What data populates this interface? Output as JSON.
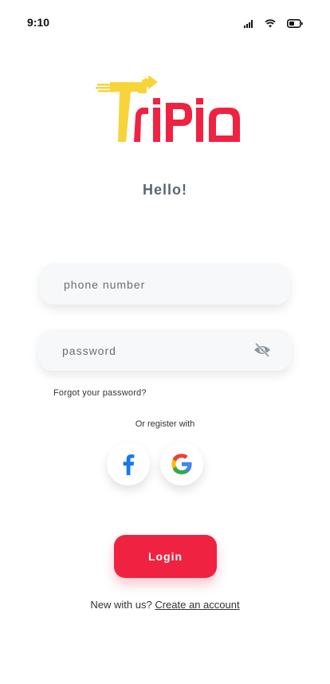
{
  "status_bar": {
    "time": "9:10",
    "icons": [
      "signal-icon",
      "wifi-icon",
      "battery-icon"
    ]
  },
  "logo": {
    "text": "TriPia",
    "colors": {
      "primary": "#ef2341",
      "secondary": "#f7d43a"
    }
  },
  "greeting": "Hello!",
  "form": {
    "phone_placeholder": "phone number",
    "password_placeholder": "password",
    "eye_icon": "eye-slash-icon"
  },
  "forgot_password": "Forgot your password?",
  "social": {
    "label": "Or register with",
    "providers": [
      "facebook",
      "google"
    ]
  },
  "login_label": "Login",
  "signup": {
    "prompt": "New with us?",
    "link": "Create an account"
  },
  "colors": {
    "accent": "#ef2341",
    "greeting": "#5b6670"
  }
}
